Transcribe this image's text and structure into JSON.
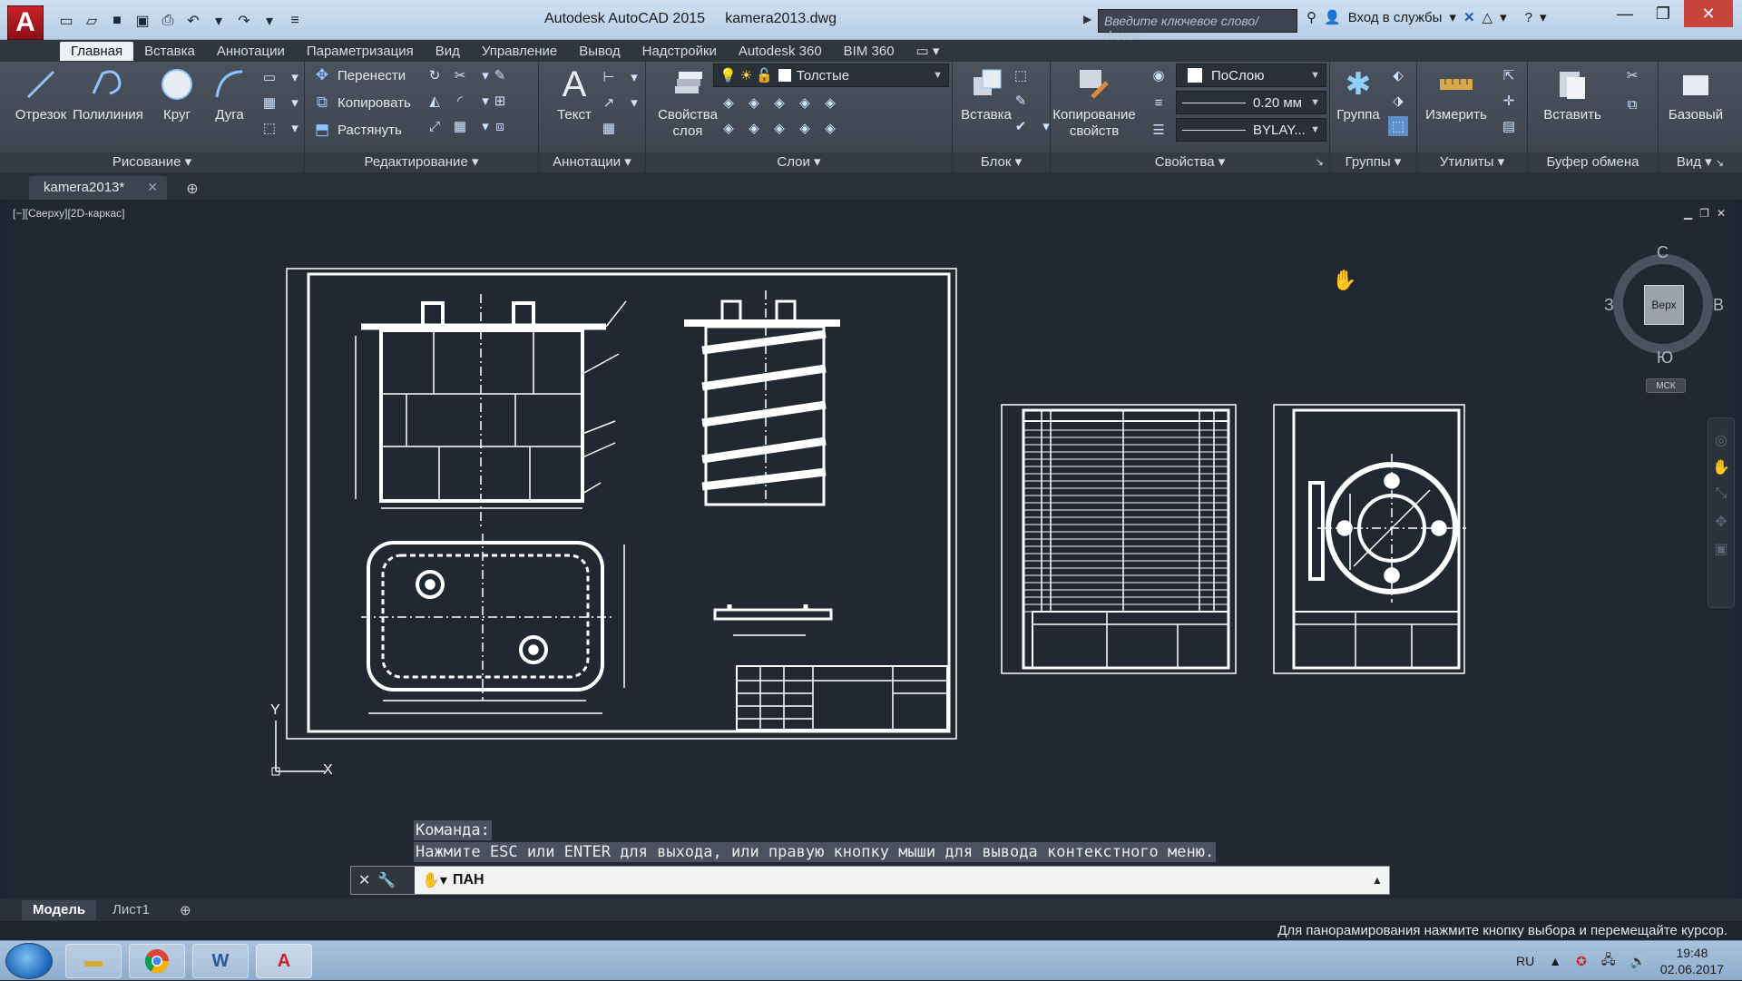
{
  "window": {
    "app_title": "Autodesk AutoCAD 2015",
    "file_name": "kamera2013.dwg",
    "search_placeholder": "Введите ключевое слово/фразу",
    "sign_in": "Вход в службы"
  },
  "ribbon_tabs": [
    "Главная",
    "Вставка",
    "Аннотации",
    "Параметризация",
    "Вид",
    "Управление",
    "Вывод",
    "Надстройки",
    "Autodesk 360",
    "BIM 360"
  ],
  "panels": {
    "draw": {
      "title": "Рисование",
      "tools": [
        "Отрезок",
        "Полилиния",
        "Круг",
        "Дуга"
      ]
    },
    "modify": {
      "title": "Редактирование",
      "tools": [
        "Перенести",
        "Копировать",
        "Растянуть"
      ]
    },
    "annotation": {
      "title": "Аннотации",
      "text": "Текст"
    },
    "layers": {
      "title": "Слои",
      "layer_props": "Свойства слоя",
      "current_layer": "Толстые"
    },
    "block": {
      "title": "Блок",
      "insert": "Вставка"
    },
    "properties": {
      "title": "Свойства",
      "match": "Копирование свойств",
      "color": "ПоСлою",
      "lineweight": "0.20 мм",
      "linetype": "BYLAY..."
    },
    "groups": {
      "title": "Группы",
      "group": "Группа"
    },
    "utilities": {
      "title": "Утилиты",
      "measure": "Измерить"
    },
    "clipboard": {
      "title": "Буфер обмена",
      "paste": "Вставить"
    },
    "view": {
      "title": "Вид",
      "base": "Базовый"
    }
  },
  "doc_tab": {
    "label": "kamera2013*"
  },
  "viewport_label": "[−][Сверху][2D-каркас]",
  "viewcube": {
    "face": "Верх",
    "north": "С",
    "south": "Ю",
    "west": "З",
    "east": "В",
    "ucs": "МСК"
  },
  "ucs_icon": {
    "x": "X",
    "y": "Y"
  },
  "command": {
    "history": [
      "Команда:",
      "Нажмите ESC или ENTER для выхода, или правую кнопку мыши для вывода контекстного меню."
    ],
    "current": "ПАН"
  },
  "layout_tabs": [
    "Модель",
    "Лист1"
  ],
  "status_message": "Для панорамирования нажмите кнопку выбора и перемещайте курсор.",
  "taskbar": {
    "lang": "RU",
    "time": "19:48",
    "date": "02.06.2017"
  },
  "colors": {
    "canvas": "#212832",
    "drawing_lines": "#ffffff",
    "app_red": "#c8222a"
  }
}
